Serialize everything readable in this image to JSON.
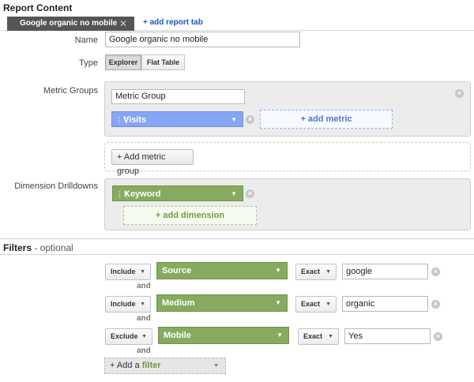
{
  "report_content": {
    "title": "Report Content",
    "active_tab": "Google organic no mobile",
    "add_tab": "+ add report tab",
    "name_label": "Name",
    "name_value": "Google organic no mobile",
    "type_label": "Type",
    "type_options": [
      "Explorer",
      "Flat Table"
    ],
    "type_selected": "Explorer",
    "metric_groups_label": "Metric Groups",
    "metric_group_name": "Metric Group",
    "metric_pill": "Visits",
    "add_metric": "+ add metric",
    "add_metric_group": "+ Add metric group",
    "dimension_label": "Dimension Drilldowns",
    "dimension_pill": "Keyword",
    "add_dimension": "+ add dimension"
  },
  "filters": {
    "title": "Filters",
    "optional": " - optional",
    "and_label": "and",
    "rows": [
      {
        "mode": "Include",
        "dimension": "Source",
        "match": "Exact",
        "value": "google"
      },
      {
        "mode": "Include",
        "dimension": "Medium",
        "match": "Exact",
        "value": "organic"
      },
      {
        "mode": "Exclude",
        "dimension": "Mobile",
        "match": "Exact",
        "value": "Yes"
      }
    ],
    "add_filter_prefix": "+ Add a ",
    "add_filter_word": "filter"
  },
  "icons": {
    "close": "close-icon",
    "caret": "caret-down-icon",
    "grip": "drag-handle-icon",
    "remove": "remove-circle-icon"
  },
  "colors": {
    "metric_pill": "#86a6f5",
    "dimension_pill": "#86ab5f",
    "active_tab": "#555555",
    "link": "#1a57c1"
  }
}
